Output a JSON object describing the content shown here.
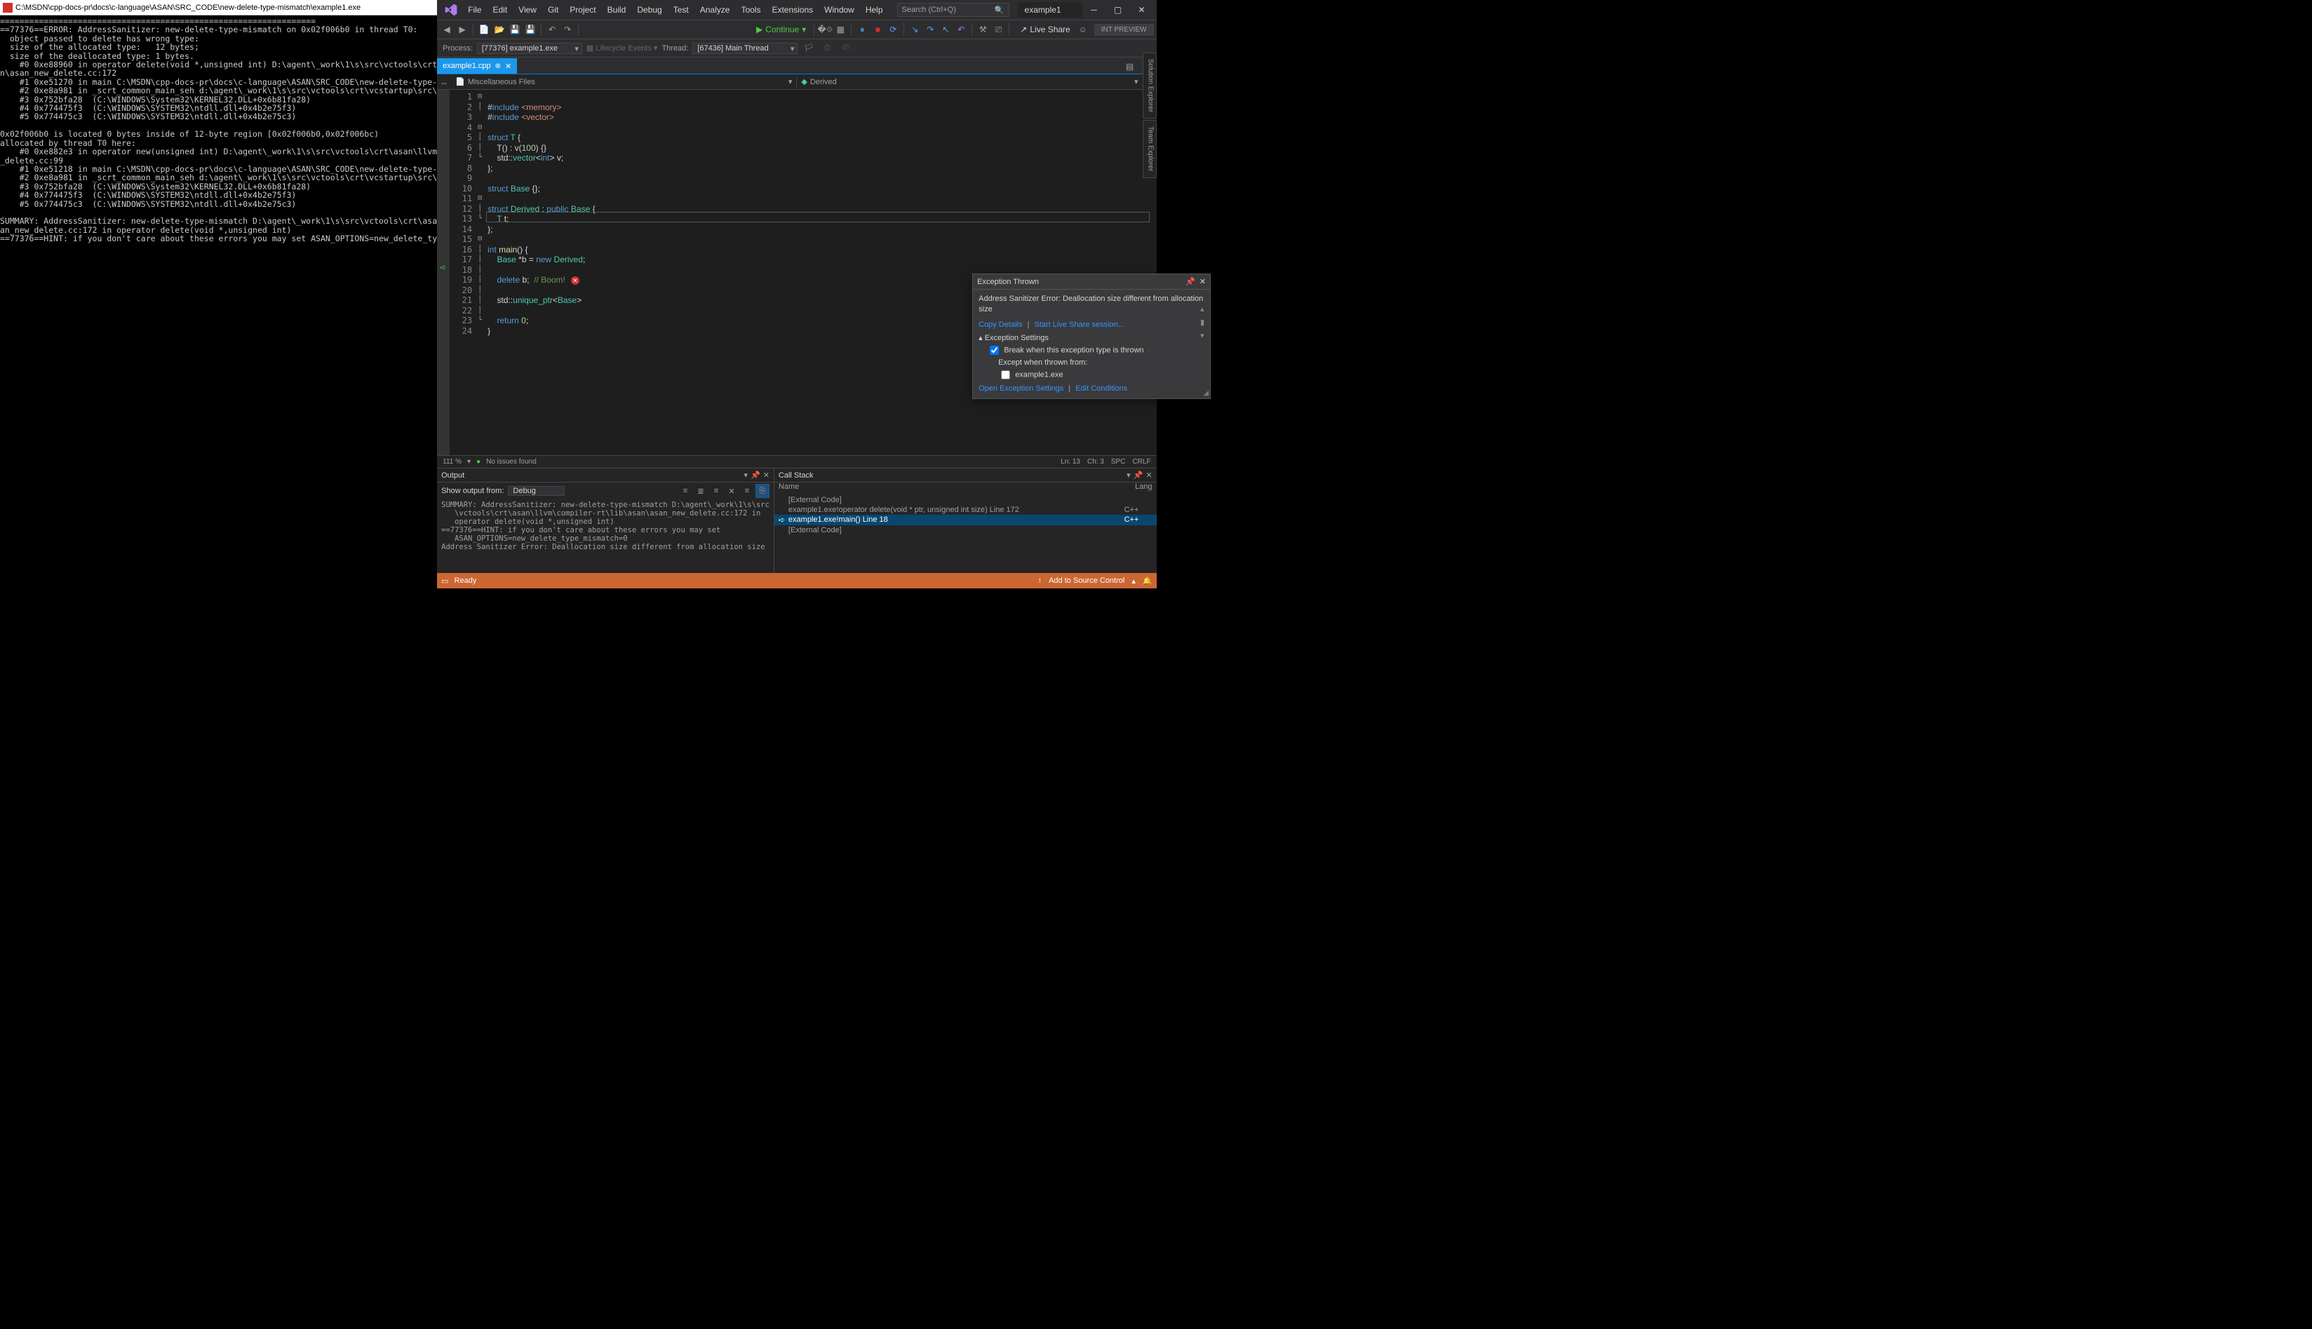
{
  "console": {
    "title": "C:\\MSDN\\cpp-docs-pr\\docs\\c-language\\ASAN\\SRC_CODE\\new-delete-type-mismatch\\example1.exe",
    "text": "=================================================================\n==77376==ERROR: AddressSanitizer: new-delete-type-mismatch on 0x02f006b0 in thread T0:\n  object passed to delete has wrong type:\n  size of the allocated type:   12 bytes;\n  size of the deallocated type: 1 bytes.\n    #0 0xe88960 in operator delete(void *,unsigned int) D:\\agent\\_work\\1\\s\\src\\vctools\\crt\nn\\asan_new_delete.cc:172\n    #1 0xe51270 in main C:\\MSDN\\cpp-docs-pr\\docs\\c-language\\ASAN\\SRC_CODE\\new-delete-type-\n    #2 0xe8a981 in _scrt_common_main_seh d:\\agent\\_work\\1\\s\\src\\vctools\\crt\\vcstartup\\src\\\n    #3 0x752bfa28  (C:\\WINDOWS\\System32\\KERNEL32.DLL+0x6b81fa28)\n    #4 0x774475f3  (C:\\WINDOWS\\SYSTEM32\\ntdll.dll+0x4b2e75f3)\n    #5 0x774475c3  (C:\\WINDOWS\\SYSTEM32\\ntdll.dll+0x4b2e75c3)\n\n0x02f006b0 is located 0 bytes inside of 12-byte region [0x02f006b0,0x02f006bc)\nallocated by thread T0 here:\n    #0 0xe882e3 in operator new(unsigned int) D:\\agent\\_work\\1\\s\\src\\vctools\\crt\\asan\\llvm\n_delete.cc:99\n    #1 0xe51218 in main C:\\MSDN\\cpp-docs-pr\\docs\\c-language\\ASAN\\SRC_CODE\\new-delete-type-\n    #2 0xe8a981 in _scrt_common_main_seh d:\\agent\\_work\\1\\s\\src\\vctools\\crt\\vcstartup\\src\\\n    #3 0x752bfa28  (C:\\WINDOWS\\System32\\KERNEL32.DLL+0x6b81fa28)\n    #4 0x774475f3  (C:\\WINDOWS\\SYSTEM32\\ntdll.dll+0x4b2e75f3)\n    #5 0x774475c3  (C:\\WINDOWS\\SYSTEM32\\ntdll.dll+0x4b2e75c3)\n\nSUMMARY: AddressSanitizer: new-delete-type-mismatch D:\\agent\\_work\\1\\s\\src\\vctools\\crt\\asa\nan_new_delete.cc:172 in operator delete(void *,unsigned int)\n==77376==HINT: if you don't care about these errors you may set ASAN_OPTIONS=new_delete_ty"
  },
  "menu": [
    "File",
    "Edit",
    "View",
    "Git",
    "Project",
    "Build",
    "Debug",
    "Test",
    "Analyze",
    "Tools",
    "Extensions",
    "Window",
    "Help"
  ],
  "search_placeholder": "Search (Ctrl+Q)",
  "title": "example1",
  "continue_label": "Continue",
  "liveshare_label": "Live Share",
  "intpreview_label": "INT PREVIEW",
  "process_label": "Process:",
  "process_value": "[77376] example1.exe",
  "lifecycle_label": "Lifecycle Events",
  "thread_label": "Thread:",
  "thread_value": "[67436] Main Thread",
  "tab_name": "example1.cpp",
  "nav_left": "Miscellaneous Files",
  "nav_right": "Derived",
  "code_lines": 24,
  "zoom": "111 %",
  "issues": "No issues found",
  "pos_line": "Ln: 13",
  "pos_col": "Ch: 3",
  "pos_spc": "SPC",
  "pos_crlf": "CRLF",
  "exception": {
    "title": "Exception Thrown",
    "message": "Address Sanitizer Error: Deallocation size different from allocation size",
    "copy": "Copy Details",
    "liveshare": "Start Live Share session...",
    "settings_header": "Exception Settings",
    "break_label": "Break when this exception type is thrown",
    "except_label": "Except when thrown from:",
    "except_item": "example1.exe",
    "open_settings": "Open Exception Settings",
    "edit_cond": "Edit Conditions"
  },
  "output": {
    "title": "Output",
    "show_label": "Show output from:",
    "show_value": "Debug",
    "text": "SUMMARY: AddressSanitizer: new-delete-type-mismatch D:\\agent\\_work\\1\\s\\src\n   \\vctools\\crt\\asan\\llvm\\compiler-rt\\lib\\asan\\asan_new_delete.cc:172 in\n   operator delete(void *,unsigned int)\n==77376==HINT: if you don't care about these errors you may set\n   ASAN_OPTIONS=new_delete_type_mismatch=0\nAddress Sanitizer Error: Deallocation size different from allocation size"
  },
  "callstack": {
    "title": "Call Stack",
    "col_name": "Name",
    "col_lang": "Lang",
    "rows": [
      {
        "name": "[External Code]",
        "lang": "",
        "dim": true,
        "cur": false
      },
      {
        "name": "example1.exe!operator delete(void * ptr, unsigned int size) Line 172",
        "lang": "C++",
        "dim": true,
        "cur": false
      },
      {
        "name": "example1.exe!main() Line 18",
        "lang": "C++",
        "dim": false,
        "cur": true
      },
      {
        "name": "[External Code]",
        "lang": "",
        "dim": true,
        "cur": false
      }
    ]
  },
  "status": {
    "ready": "Ready",
    "add_sc": "Add to Source Control"
  },
  "sidetools": [
    "Solution Explorer",
    "Team Explorer"
  ]
}
